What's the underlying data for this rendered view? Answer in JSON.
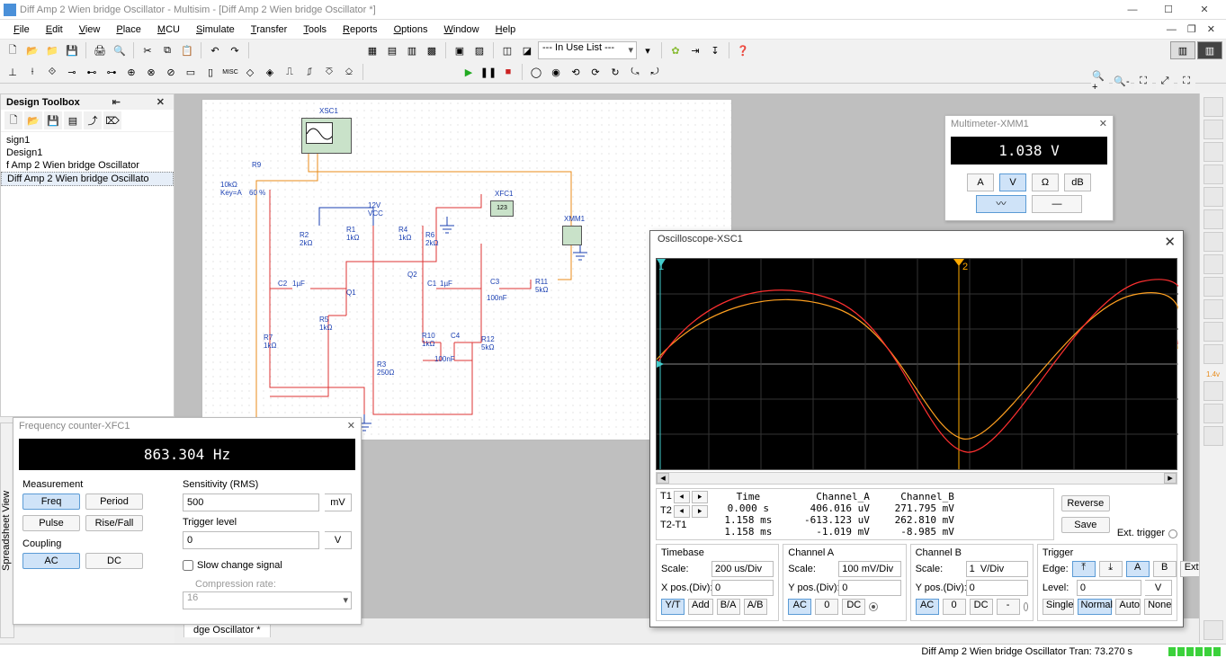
{
  "window": {
    "title": "Diff Amp 2 Wien bridge Oscillator - Multisim - [Diff Amp 2 Wien bridge Oscillator *]"
  },
  "menu": [
    "File",
    "Edit",
    "View",
    "Place",
    "MCU",
    "Simulate",
    "Transfer",
    "Tools",
    "Reports",
    "Options",
    "Window",
    "Help"
  ],
  "toolbar": {
    "inuse": "--- In Use List ---"
  },
  "toolbox": {
    "title": "Design Toolbox",
    "items": [
      "sign1",
      "Design1",
      "f Amp 2 Wien bridge Oscillator",
      "Diff Amp 2 Wien bridge Oscillato"
    ]
  },
  "schematic": {
    "name": "XSC1",
    "tab": "dge Oscillator *",
    "labels": {
      "r9": "R9",
      "r9v1": "10kΩ",
      "r9v2": "Key=A",
      "r9v3": "60 %",
      "vcc1": "12V",
      "vcc2": "VCC",
      "xfc1": "XFC1",
      "xmm1": "XMM1",
      "r2": "R2",
      "r2v": "2kΩ",
      "r1": "R1",
      "r1v": "1kΩ",
      "r4": "R4",
      "r4v": "1kΩ",
      "r6": "R6",
      "r6v": "2kΩ",
      "c1": "C1",
      "c1v": "1µF",
      "c2": "C2",
      "c2v": "1µF",
      "c3": "C3",
      "c3v": "100nF",
      "c4": "C4",
      "c4v": "100nF",
      "q1": "Q1",
      "q2": "Q2",
      "r5": "R5",
      "r5v": "1kΩ",
      "r7": "R7",
      "r7v": "1kΩ",
      "r10": "R10",
      "r10v": "1kΩ",
      "r11": "R11",
      "r11v": "5kΩ",
      "r12": "R12",
      "r12v": "5kΩ",
      "r3": "R3",
      "r3v": "250Ω"
    }
  },
  "multimeter": {
    "title": "Multimeter-XMM1",
    "value": "1.038 V",
    "btns": {
      "a": "A",
      "v": "V",
      "ohm": "Ω",
      "db": "dB"
    }
  },
  "freq": {
    "title": "Frequency counter-XFC1",
    "value": "863.304 Hz",
    "measurement": "Measurement",
    "freq": "Freq",
    "period": "Period",
    "pulse": "Pulse",
    "risefall": "Rise/Fall",
    "coupling": "Coupling",
    "ac": "AC",
    "dc": "DC",
    "sens": "Sensitivity (RMS)",
    "sens_val": "500",
    "sens_unit": "mV",
    "trig": "Trigger level",
    "trig_val": "0",
    "trig_unit": "V",
    "slow": "Slow change signal",
    "comp": "Compression rate:",
    "comp_val": "16"
  },
  "scope": {
    "title": "Oscilloscope-XSC1",
    "cols": {
      "head_t": "Time",
      "head_a": "Channel_A",
      "head_b": "Channel_B",
      "t1": "T1",
      "t2": "T2",
      "dt": "T2-T1",
      "t1_time": "0.000 s",
      "t1_a": "406.016 uV",
      "t1_b": "271.795 mV",
      "t2_time": "1.158 ms",
      "t2_a": "-613.123 uV",
      "t2_b": "262.810 mV",
      "dt_time": "1.158 ms",
      "dt_a": "-1.019 mV",
      "dt_b": "-8.985 mV"
    },
    "reverse": "Reverse",
    "save": "Save",
    "ext": "Ext. trigger",
    "tb": {
      "title": "Timebase",
      "scale": "Scale:",
      "scale_v": "200 us/Div",
      "xpos": "X pos.(Div):",
      "xpos_v": "0",
      "yt": "Y/T",
      "add": "Add",
      "ba": "B/A",
      "ab": "A/B"
    },
    "ca": {
      "title": "Channel A",
      "scale": "Scale:",
      "scale_v": "100 mV/Div",
      "ypos": "Y pos.(Div):",
      "ypos_v": "0",
      "ac": "AC",
      "zero": "0",
      "dc": "DC"
    },
    "cb": {
      "title": "Channel B",
      "scale": "Scale:",
      "scale_v": "1  V/Div",
      "ypos": "Y pos.(Div):",
      "ypos_v": "0",
      "ac": "AC",
      "zero": "0",
      "dc": "DC",
      "minus": "-"
    },
    "tr": {
      "title": "Trigger",
      "edge": "Edge:",
      "level": "Level:",
      "level_v": "0",
      "level_u": "V",
      "a": "A",
      "b": "B",
      "ext_b": "Ext",
      "single": "Single",
      "normal": "Normal",
      "auto": "Auto",
      "none": "None"
    },
    "hint": "1.4v"
  },
  "status": {
    "text": "Diff Amp 2 Wien bridge Oscillator  Tran: 73.270 s"
  },
  "chart_data": {
    "type": "line",
    "title": "Oscilloscope-XSC1",
    "xlabel": "Time",
    "timebase_per_div": "200 us",
    "channels": [
      {
        "name": "Channel_A",
        "color": "#ff3030",
        "scale_per_div": "100 mV",
        "waveform": "sine",
        "period_ms": 1.158,
        "amplitude_approx": "~1 mV (drawn ~3.3 div)",
        "sample_points_div_units": [
          [
            0,
            0
          ],
          [
            1,
            2.2
          ],
          [
            2,
            3.2
          ],
          [
            3,
            3.2
          ],
          [
            4,
            2.1
          ],
          [
            5,
            0
          ]
        ]
      },
      {
        "name": "Channel_B",
        "color": "#ffa020",
        "scale_per_div": "1 V",
        "waveform": "sine",
        "period_ms": 1.158,
        "amplitude_approx": "~270 mV (drawn ~2.8 div)",
        "sample_points_div_units": [
          [
            0,
            0.3
          ],
          [
            1,
            2.0
          ],
          [
            2,
            2.8
          ],
          [
            3,
            2.7
          ],
          [
            4,
            1.7
          ],
          [
            5,
            -0.2
          ]
        ]
      }
    ],
    "cursors": [
      {
        "name": "T1",
        "time": "0.000 s",
        "ch_a": "406.016 uV",
        "ch_b": "271.795 mV"
      },
      {
        "name": "T2",
        "time": "1.158 ms",
        "ch_a": "-613.123 uV",
        "ch_b": "262.810 mV"
      },
      {
        "name": "T2-T1",
        "time": "1.158 ms",
        "ch_a": "-1.019 mV",
        "ch_b": "-8.985 mV"
      }
    ]
  },
  "spreadsheet_tab": "Spreadsheet View"
}
